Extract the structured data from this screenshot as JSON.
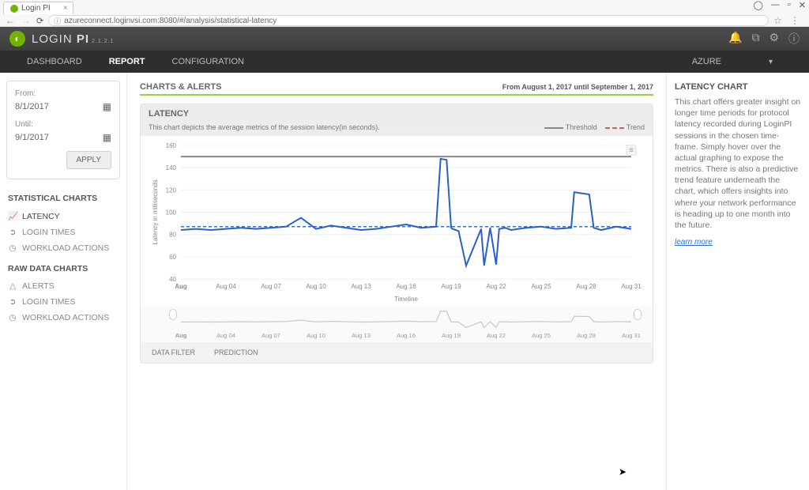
{
  "browser": {
    "tab_title": "Login PI",
    "url": "azureconnect.loginvsi.com:8080/#/analysis/statistical-latency"
  },
  "header": {
    "brand_a": "LOGIN",
    "brand_b": "PI",
    "version": "2.1.2.1"
  },
  "nav": {
    "items": [
      "DASHBOARD",
      "REPORT",
      "CONFIGURATION"
    ],
    "active": "REPORT",
    "right": "AZURE"
  },
  "sidebar_left": {
    "from_label": "From:",
    "from_value": "8/1/2017",
    "until_label": "Until:",
    "until_value": "9/1/2017",
    "apply": "APPLY",
    "heading_stat": "STATISTICAL CHARTS",
    "heading_raw": "RAW DATA CHARTS",
    "stat_items": [
      "LATENCY",
      "LOGIN TIMES",
      "WORKLOAD ACTIONS"
    ],
    "raw_items": [
      "ALERTS",
      "LOGIN TIMES",
      "WORKLOAD ACTIONS"
    ]
  },
  "content": {
    "section_title": "CHARTS & ALERTS",
    "section_date": "From August 1, 2017 until September 1, 2017",
    "panel_title": "LATENCY",
    "panel_sub": "This chart depicts the average metrics of the session latency(in seconds).",
    "legend_threshold": "Threshold",
    "legend_trend": "Trend",
    "ylabel": "Latency in milliseconds",
    "xlabel": "Timeline",
    "tabs": [
      "DATA FILTER",
      "PREDICTION"
    ]
  },
  "sidebar_right": {
    "title": "LATENCY CHART",
    "body": "This chart offers greater insight on longer time periods for protocol latency recorded during LoginPI sessions in the chosen time-frame. Simply hover over the actual graphing to expose the metrics. There is also a predictive trend feature underneath the chart, which offers insights into where your network performance is heading up to one month into the future.",
    "learn_more": "learn more"
  },
  "chart_data": {
    "type": "line",
    "title": "LATENCY",
    "xlabel": "Timeline",
    "ylabel": "Latency in milliseconds",
    "ylim": [
      40,
      160
    ],
    "yticks": [
      40,
      60,
      80,
      100,
      120,
      140,
      160
    ],
    "x_categories": [
      "Aug",
      "Aug 04",
      "Aug 07",
      "Aug 10",
      "Aug 13",
      "Aug 16",
      "Aug 19",
      "Aug 22",
      "Aug 25",
      "Aug 28",
      "Aug 31"
    ],
    "threshold": 150,
    "trend_level": 87,
    "series": [
      {
        "name": "Latency",
        "x": [
          1,
          2,
          3,
          4,
          5,
          6,
          7,
          8,
          9,
          10,
          11,
          12,
          13,
          14,
          15,
          16,
          17,
          18,
          18.3,
          18.7,
          19,
          19.1,
          19.5,
          20,
          21,
          21.2,
          21.6,
          22,
          22.2,
          22.6,
          23,
          24,
          25,
          26,
          27,
          27.2,
          28.2,
          28.5,
          29,
          30,
          31
        ],
        "y": [
          84,
          85,
          84,
          85,
          86,
          85,
          86,
          87,
          95,
          85,
          88,
          86,
          84,
          85,
          87,
          89,
          86,
          87,
          148,
          147,
          86,
          85,
          83,
          52,
          85,
          52,
          86,
          53,
          85,
          86,
          84,
          86,
          87,
          85,
          86,
          118,
          116,
          86,
          84,
          87,
          85
        ]
      }
    ]
  }
}
